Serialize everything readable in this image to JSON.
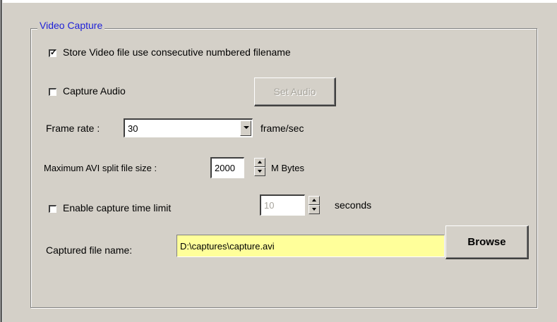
{
  "group": {
    "title": "Video Capture"
  },
  "store_numbered": {
    "label": "Store Video file use consecutive numbered filename",
    "checked": true,
    "mark": "✓"
  },
  "capture_audio": {
    "label": "Capture Audio",
    "checked": false
  },
  "set_audio": {
    "label": "Set Audio",
    "enabled": false
  },
  "frame_rate": {
    "label": "Frame rate :",
    "value": "30",
    "unit": "frame/sec"
  },
  "avi_split": {
    "label": "Maximum AVI split file size :",
    "value": "2000",
    "unit": "M Bytes"
  },
  "time_limit": {
    "label": "Enable capture time limit",
    "checked": false,
    "value": "10",
    "unit": "seconds"
  },
  "captured_file": {
    "label": "Captured file name:",
    "value": "D:\\captures\\capture.avi",
    "field_color": "#ffff9a"
  },
  "browse": {
    "label": "Browse"
  },
  "colors": {
    "group_title": "#1f22d8",
    "window_bg": "#d4d0c8"
  }
}
